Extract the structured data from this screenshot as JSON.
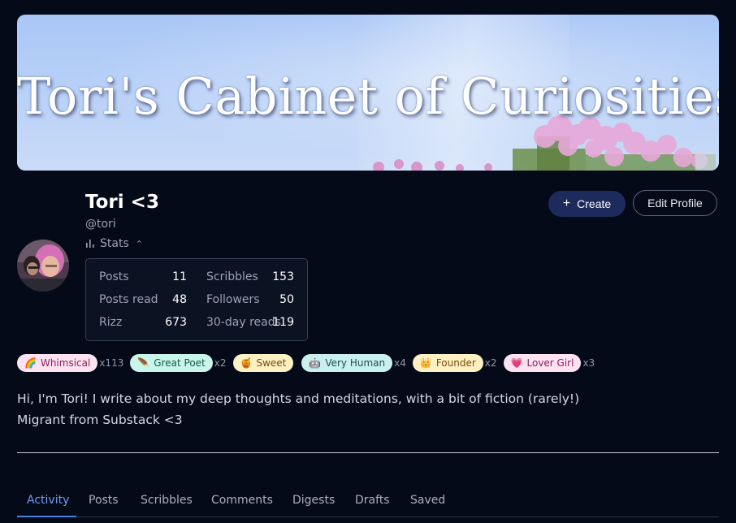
{
  "banner": {
    "title": "Tori's Cabinet of Curiosities"
  },
  "profile": {
    "name": "Tori <3",
    "handle": "@tori",
    "stats_label": "Stats",
    "stats_chevron": "⌃"
  },
  "stats": [
    {
      "label": "Posts",
      "value": "11"
    },
    {
      "label": "Scribbles",
      "value": "153"
    },
    {
      "label": "Posts read",
      "value": "48"
    },
    {
      "label": "Followers",
      "value": "50"
    },
    {
      "label": "Rizz",
      "value": "673"
    },
    {
      "label": "30-day reads",
      "value": "119"
    }
  ],
  "actions": {
    "create_label": "Create",
    "edit_label": "Edit Profile"
  },
  "badges": [
    {
      "emoji": "🌈",
      "label": "Whimsical",
      "count": "x113",
      "bg": "#fde3f1",
      "fg": "#8a1f5c"
    },
    {
      "emoji": "🪶",
      "label": "Great Poet",
      "count": "x2",
      "bg": "#c9f5ea",
      "fg": "#14594a"
    },
    {
      "emoji": "🍯",
      "label": "Sweet",
      "count": "",
      "bg": "#fdf0c2",
      "fg": "#7a4a07"
    },
    {
      "emoji": "🤖",
      "label": "Very Human",
      "count": "x4",
      "bg": "#c9f0ef",
      "fg": "#1b4f55"
    },
    {
      "emoji": "👑",
      "label": "Founder",
      "count": "x2",
      "bg": "#fdf0c2",
      "fg": "#7a4a07"
    },
    {
      "emoji": "💗",
      "label": "Lover Girl",
      "count": "x3",
      "bg": "#fde3f1",
      "fg": "#8a1f5c"
    }
  ],
  "bio": {
    "line1": "Hi, I'm Tori! I write about my deep thoughts and meditations, with a bit of fiction (rarely!)",
    "line2": "Migrant from Substack <3"
  },
  "tabs": [
    {
      "label": "Activity",
      "active": true
    },
    {
      "label": "Posts",
      "active": false
    },
    {
      "label": "Scribbles",
      "active": false
    },
    {
      "label": "Comments",
      "active": false
    },
    {
      "label": "Digests",
      "active": false
    },
    {
      "label": "Drafts",
      "active": false
    },
    {
      "label": "Saved",
      "active": false
    }
  ],
  "colors": {
    "accent": "#4c7ee0",
    "background": "#050a18",
    "create_button": "#1d2a5c"
  },
  "icons": {
    "create": "plus-icon",
    "stats": "bar-chart-icon",
    "chevron": "chevron-up-icon"
  }
}
